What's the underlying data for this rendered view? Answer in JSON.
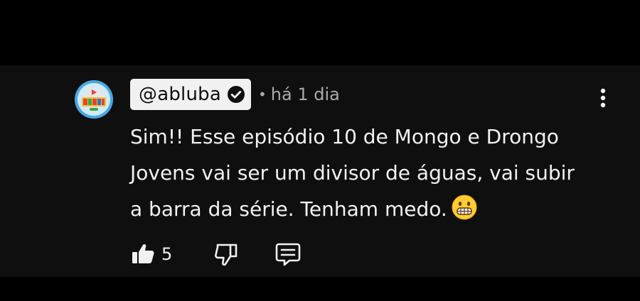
{
  "comment": {
    "author": "@abluba",
    "verified": true,
    "separator": "•",
    "timestamp": "há 1 dia",
    "text": "Sim!! Esse episódio 10 de Mongo e Drongo Jovens vai ser um divisor de águas, vai subir a barra da série. Tenham medo.",
    "emoji": "grimacing-face-emoji",
    "avatar_icon": "channel-avatar-logo",
    "menu_icon": "kebab-menu-icon"
  },
  "actions": {
    "like_icon": "thumbs-up-icon",
    "like_count": "5",
    "dislike_icon": "thumbs-down-icon",
    "reply_icon": "reply-comment-icon"
  },
  "colors": {
    "background": "#0f0f0f",
    "text": "#f1f1f1",
    "muted": "#aaaaaa",
    "author_chip": "#f1f1f1"
  }
}
